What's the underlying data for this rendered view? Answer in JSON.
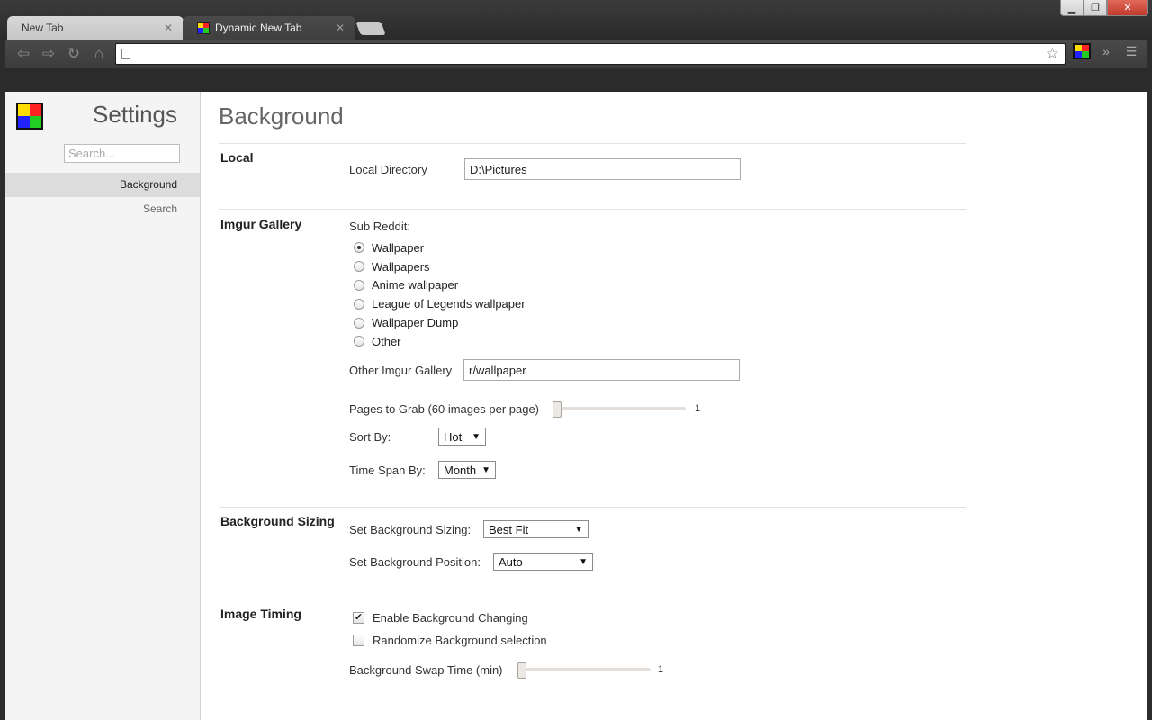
{
  "browser": {
    "tabs": [
      {
        "label": "New Tab",
        "active": false
      },
      {
        "label": "Dynamic New Tab",
        "active": true
      }
    ],
    "address": "",
    "window_controls": {
      "minimize": "▁",
      "maximize": "❐",
      "close": "✕"
    }
  },
  "sidebar": {
    "title": "Settings",
    "search_placeholder": "Search...",
    "items": [
      {
        "label": "Background",
        "selected": true
      },
      {
        "label": "Search",
        "selected": false
      }
    ]
  },
  "main": {
    "heading": "Background",
    "local": {
      "label": "Local",
      "directory_label": "Local Directory",
      "directory_value": "D:\\Pictures"
    },
    "imgur": {
      "label": "Imgur Gallery",
      "subreddit_label": "Sub Reddit:",
      "options": [
        "Wallpaper",
        "Wallpapers",
        "Anime wallpaper",
        "League of Legends wallpaper",
        "Wallpaper Dump",
        "Other"
      ],
      "selected_option": "Wallpaper",
      "other_label": "Other Imgur Gallery",
      "other_value": "r/wallpaper",
      "pages_label": "Pages to Grab (60 images per page)",
      "pages_value": "1",
      "sort_label": "Sort By:",
      "sort_value": "Hot",
      "timespan_label": "Time Span By:",
      "timespan_value": "Month"
    },
    "sizing": {
      "label": "Background Sizing",
      "sizing_label": "Set Background Sizing:",
      "sizing_value": "Best Fit",
      "position_label": "Set Background Position:",
      "position_value": "Auto"
    },
    "timing": {
      "label": "Image Timing",
      "enable_label": "Enable Background Changing",
      "enable_checked": true,
      "randomize_label": "Randomize Background selection",
      "randomize_checked": false,
      "swap_label": "Background Swap Time (min)",
      "swap_value": "1"
    }
  }
}
